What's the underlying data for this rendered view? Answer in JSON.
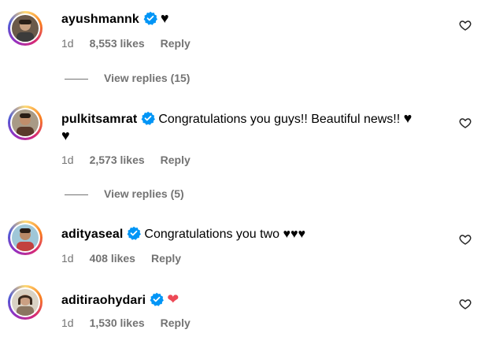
{
  "comments": [
    {
      "username": "ayushmannk",
      "text": "",
      "emoji": "♥",
      "time": "1d",
      "likes": "8,553 likes",
      "reply": "Reply",
      "view_replies": "View replies (15)"
    },
    {
      "username": "pulkitsamrat",
      "text": "Congratulations you guys!! Beautiful news!!",
      "emoji": "♥",
      "emoji_wrap": "♥",
      "time": "1d",
      "likes": "2,573 likes",
      "reply": "Reply",
      "view_replies": "View replies (5)"
    },
    {
      "username": "adityaseal",
      "text": "Congratulations you two",
      "emoji": "♥♥♥",
      "time": "1d",
      "likes": "408 likes",
      "reply": "Reply"
    },
    {
      "username": "aditiraohydari",
      "text": "",
      "emoji": "❤",
      "time": "1d",
      "likes": "1,530 likes",
      "reply": "Reply"
    }
  ],
  "colors": {
    "verified": "#0095f6",
    "meta": "#737373",
    "red_heart": "#ed4956"
  },
  "icons": {
    "verified": "verified-badge-icon",
    "like": "heart-outline-icon"
  }
}
